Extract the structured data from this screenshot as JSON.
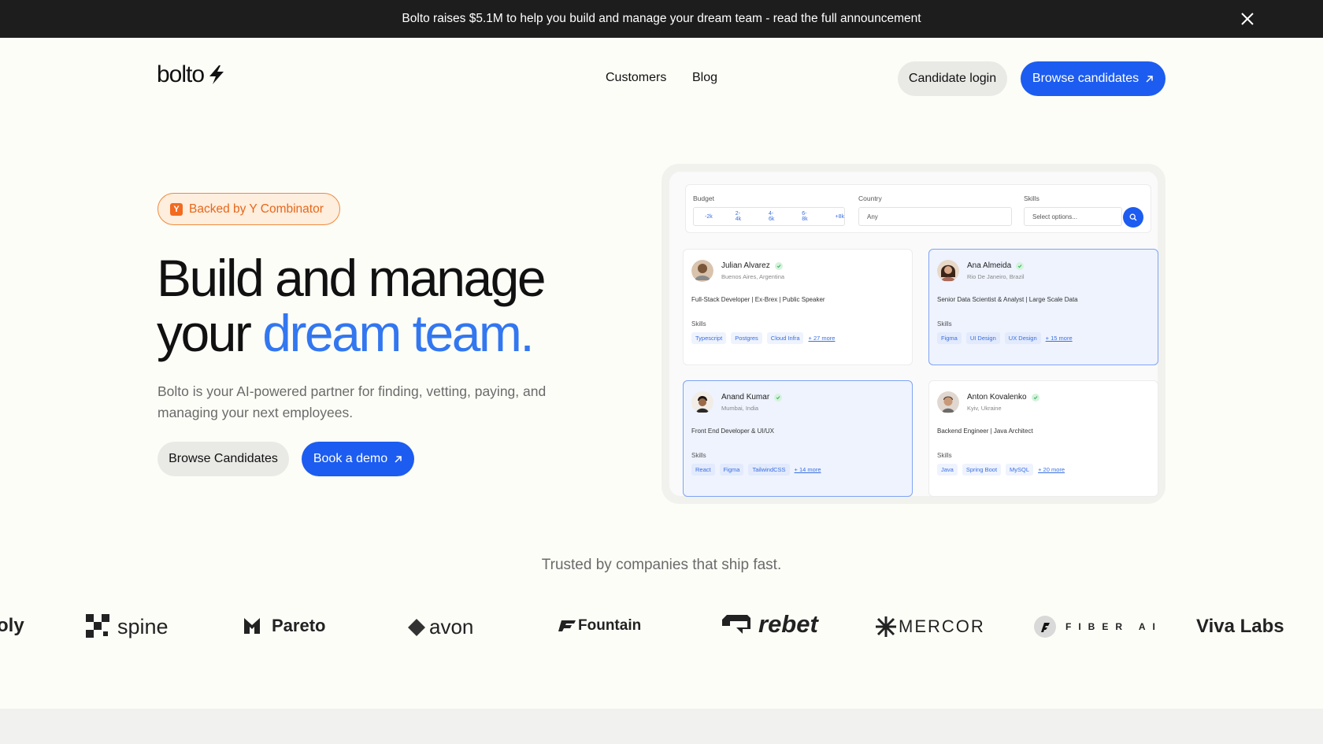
{
  "banner": {
    "text": "Bolto raises $5.1M to help you build and manage your dream team - read the full announcement"
  },
  "header": {
    "logo": "bolto",
    "nav": [
      "Customers",
      "Blog"
    ],
    "candidate_login": "Candidate login",
    "browse_candidates": "Browse candidates"
  },
  "hero": {
    "badge": "Backed by Y Combinator",
    "badge_letter": "Y",
    "title_line1": "Build and manage",
    "title_line2_plain": "your ",
    "title_line2_accent": "dream team.",
    "subtitle": "Bolto is your AI-powered partner for finding, vetting, paying, and managing your next employees.",
    "browse_button": "Browse Candidates",
    "demo_button": "Book a demo"
  },
  "mock": {
    "filters": {
      "budget_label": "Budget",
      "budget_options": [
        "-2k",
        "2-4k",
        "4-6k",
        "6-8k",
        "+8k"
      ],
      "country_label": "Country",
      "country_value": "Any",
      "skills_label": "Skills",
      "skills_placeholder": "Select options..."
    },
    "skills_heading": "Skills",
    "candidates": [
      {
        "name": "Julian Alvarez",
        "location": "Buenos Aires, Argentina",
        "role": "Full-Stack Developer | Ex-Brex | Public Speaker",
        "skills": [
          "Typescript",
          "Postgres",
          "Cloud Infra"
        ],
        "more": "+ 27 more",
        "selected": false
      },
      {
        "name": "Ana Almeida",
        "location": "Rio De Janeiro, Brazil",
        "role": "Senior Data Scientist & Analyst | Large Scale Data",
        "skills": [
          "Figma",
          "UI Design",
          "UX Design"
        ],
        "more": "+ 15 more",
        "selected": true
      },
      {
        "name": "Anand Kumar",
        "location": "Mumbai, India",
        "role": "Front End Developer & UI/UX",
        "skills": [
          "React",
          "Figma",
          "TailwindCSS"
        ],
        "more": "+ 14 more",
        "selected": true
      },
      {
        "name": "Anton Kovalenko",
        "location": "Kyiv, Ukraine",
        "role": "Backend Engineer | Java Architect",
        "skills": [
          "Java",
          "Spring Boot",
          "MySQL"
        ],
        "more": "+ 20 more",
        "selected": false
      }
    ]
  },
  "trusted": {
    "heading": "Trusted by companies that ship fast.",
    "logos": [
      "oly",
      "spine",
      "Pareto",
      "avon",
      "Fountain",
      "rebet",
      "MERCOR",
      "FIBER AI",
      "Viva Labs"
    ]
  },
  "colors": {
    "accent": "#1c5cf0",
    "accent_text": "#3377f0",
    "yc_orange": "#f26b21",
    "banner_bg": "#1d1d1d",
    "page_bg": "#fdfdf8"
  }
}
